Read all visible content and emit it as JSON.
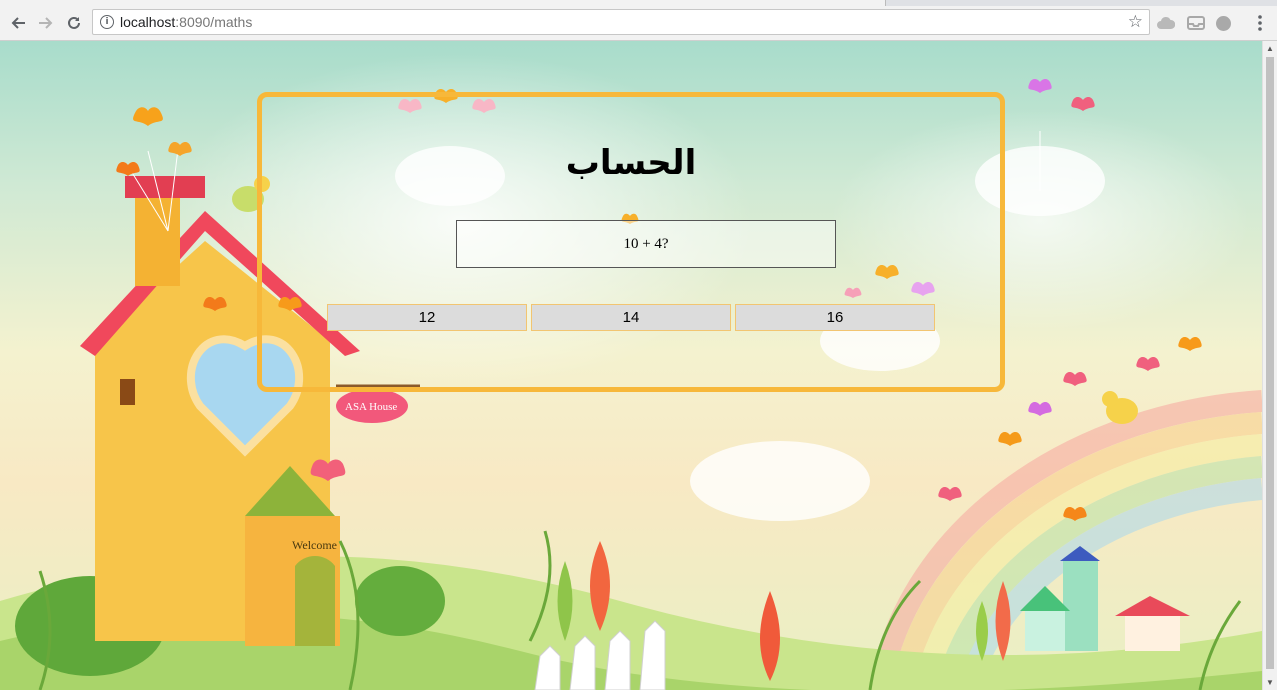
{
  "browser": {
    "url_host": "localhost",
    "url_rest": ":8090/maths",
    "back_icon": "back-arrow-icon",
    "forward_icon": "forward-arrow-icon",
    "reload_icon": "reload-icon",
    "info_icon": "info-icon",
    "bookmark_icon": "star-icon",
    "menu_icon": "kebab-menu-icon"
  },
  "page": {
    "title": "الحساب",
    "question": "10 + 4?",
    "answers": [
      "12",
      "14",
      "16"
    ],
    "background_sign": "ASA House",
    "door_sign": "Welcome"
  },
  "colors": {
    "panel_border": "#f7b83a",
    "button_bg": "#dcdcdc"
  }
}
